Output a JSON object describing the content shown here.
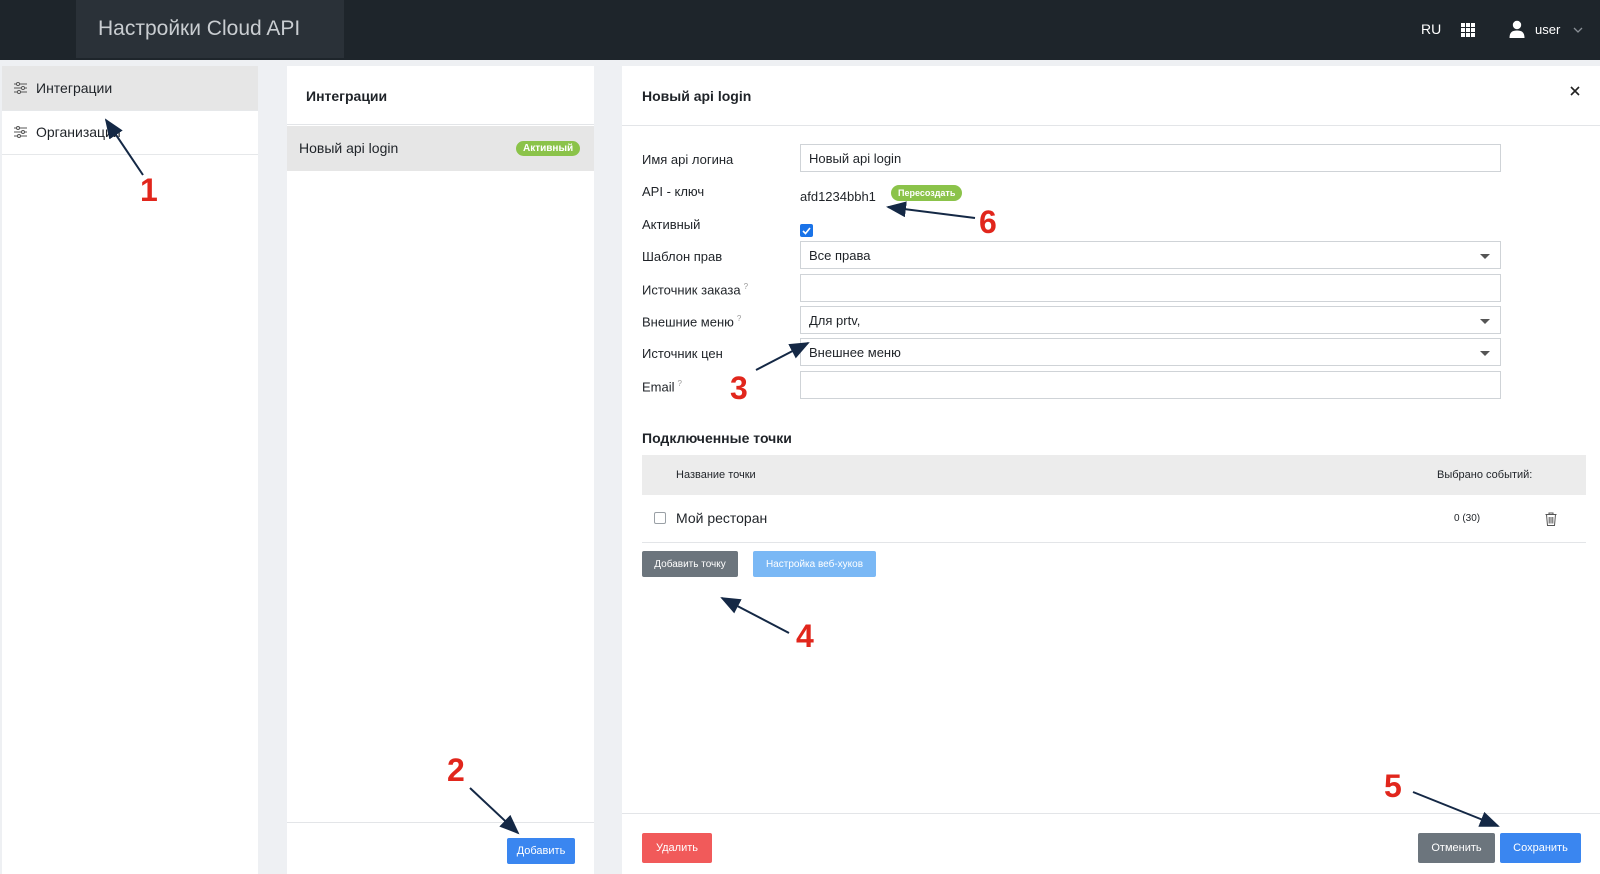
{
  "header": {
    "title": "Настройки Cloud API",
    "lang": "RU",
    "user": "user"
  },
  "sidebar": {
    "items": [
      {
        "label": "Интеграции",
        "active": true
      },
      {
        "label": "Организации",
        "active": false
      }
    ]
  },
  "integrations": {
    "title": "Интеграции",
    "items": [
      {
        "name": "Новый api login",
        "status": "Активный"
      }
    ],
    "add_button": "Добавить"
  },
  "editor": {
    "title": "Новый api login",
    "fields": {
      "login_name": {
        "label": "Имя api логина",
        "value": "Новый api login"
      },
      "api_key": {
        "label": "API - ключ",
        "value": "afd1234bbh1",
        "regen_label": "Пересоздать"
      },
      "active": {
        "label": "Активный",
        "checked": true
      },
      "rights_template": {
        "label": "Шаблон прав",
        "value": "Все права"
      },
      "order_source": {
        "label": "Источник заказа",
        "value": "",
        "hint": "?"
      },
      "external_menus": {
        "label": "Внешние меню",
        "value": "Для prtv,",
        "hint": "?"
      },
      "price_source": {
        "label": "Источник цен",
        "value": "Внешнее меню"
      },
      "email": {
        "label": "Email",
        "value": "",
        "hint": "?"
      }
    },
    "points": {
      "title": "Подключенные точки",
      "columns": [
        "Название точки",
        "Выбрано событий:"
      ],
      "rows": [
        {
          "name": "Мой ресторан",
          "events": "0 (30)"
        }
      ],
      "add_point_button": "Добавить точку",
      "webhooks_button": "Настройка веб-хуков"
    },
    "footer": {
      "delete": "Удалить",
      "cancel": "Отменить",
      "save": "Сохранить"
    }
  },
  "annotations": [
    "1",
    "2",
    "3",
    "4",
    "5",
    "6"
  ],
  "colors": {
    "topbar": "#1e252b",
    "primary": "#3a86f0",
    "success": "#8bc34a",
    "danger": "#f15a5a",
    "secondary": "#6c757d",
    "annotation": "#e1261c"
  }
}
